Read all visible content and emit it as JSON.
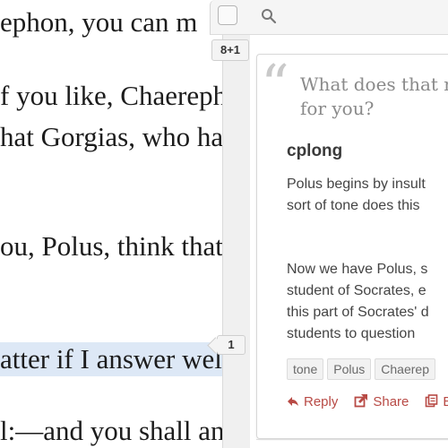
{
  "document": {
    "lines": [
      "ephon, you can m",
      "f you like, Chaereph",
      "hat Gorgias, who ha",
      "ou, Polus, think that",
      "atter if I answer wel",
      "l:—and you shall ans"
    ]
  },
  "sidebar": {
    "search_icon": "search-icon",
    "top_count": "8+1",
    "line_count": "1"
  },
  "annotation": {
    "quote": [
      "What does that m",
      "for you?"
    ],
    "user": "cplong",
    "paragraph1": [
      "Polus begins by insult",
      "sort of tone does this"
    ],
    "paragraph2": [
      "Now we have Polus, s",
      "student of Socrates, e",
      "this part of Socrates' d",
      "students to question"
    ],
    "tags": [
      "tone",
      "Polus",
      "Chaerep"
    ],
    "actions": {
      "reply": "Reply",
      "share": "Share",
      "edit": "E"
    }
  },
  "colors": {
    "accent": "#b84a45",
    "highlight": "#dde8f6"
  }
}
